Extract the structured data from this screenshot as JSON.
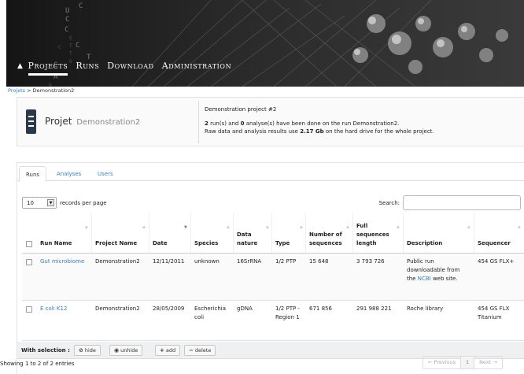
{
  "nav": {
    "items": [
      "Projects",
      "Runs",
      "Download",
      "Administration"
    ]
  },
  "breadcrumb": {
    "parent": "Projets",
    "separator": ">",
    "current": "Demonstration2"
  },
  "project": {
    "title": "Projet",
    "name": "Demonstration2",
    "description": "Demonstration project #2",
    "runs_count": "2",
    "runs_text_1": " run(s) and ",
    "analyses_count": "0",
    "runs_text_2": " analyse(s) have been done on the run Demonstration2.",
    "disk_text_1": "Raw data and analysis results use ",
    "disk_value": "2.17 Gb",
    "disk_text_2": " on the hard drive for the whole project."
  },
  "tabs": [
    "Runs",
    "Analyses",
    "Users"
  ],
  "table_controls": {
    "length_value": "10",
    "length_label": "records per page",
    "search_label": "Search:"
  },
  "table": {
    "columns": [
      "Run Name",
      "Project Name",
      "Date",
      "Species",
      "Data nature",
      "Type",
      "Number of sequences",
      "Full sequences length",
      "Description",
      "Sequencer"
    ],
    "rows": [
      {
        "run_name": "Gut microbiome",
        "project_name": "Demonstration2",
        "date": "12/11/2011",
        "species": "unknown",
        "data_nature": "16SrRNA",
        "type": "1/2 PTP",
        "num_sequences": "15 648",
        "full_length": "3 793 726",
        "description_1": "Public run",
        "description_2": "downloadable from",
        "description_3a": "the ",
        "description_link": "NCBI",
        "description_3b": " web site.",
        "sequencer": "454 GS FLX+"
      },
      {
        "run_name": "E coli K12",
        "project_name": "Demonstration2",
        "date": "28/05/2009",
        "species": "Escherichia coli",
        "data_nature": "gDNA",
        "type": "1/2 PTP - Region 1",
        "num_sequences": "671 856",
        "full_length": "291 988 221",
        "description": "Roche library",
        "sequencer": "454 GS FLX Titanium"
      }
    ]
  },
  "selection_bar": {
    "label": "With selection :",
    "hide": "hide",
    "unhide": "unhide",
    "add": "add",
    "delete": "delete"
  },
  "footer": {
    "info": "Showing 1 to 2 of 2 entries",
    "previous": "← Previous",
    "page": "1",
    "next": "Next →"
  }
}
